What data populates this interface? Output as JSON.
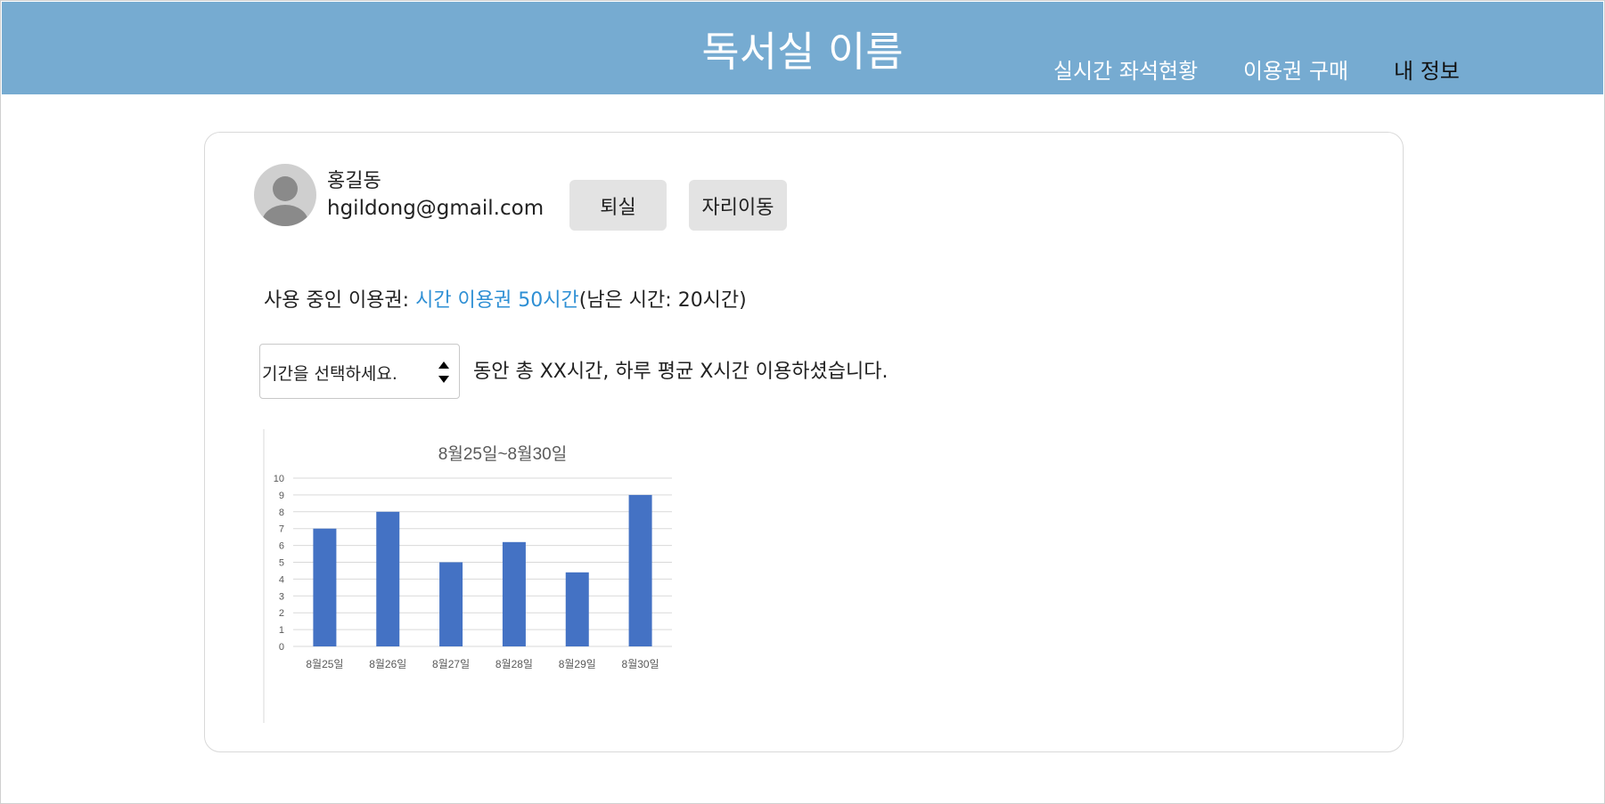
{
  "header": {
    "title": "독서실 이름",
    "nav": [
      "실시간 좌석현황",
      "이용권 구매",
      "내 정보"
    ],
    "background_color": "#76abd1"
  },
  "user": {
    "name": "홍길동",
    "email": "hgildong@gmail.com",
    "avatar_icon": "user-avatar-icon"
  },
  "actions": {
    "checkout_label": "퇴실",
    "move_seat_label": "자리이동"
  },
  "pass": {
    "prefix": "사용 중인 이용권:  ",
    "name": "시간 이용권 50시간",
    "remaining": "(남은 시간:  20시간)",
    "link_color": "#2e8fd4"
  },
  "period": {
    "placeholder": "기간을 선택하세요.",
    "summary": "동안 총 XX시간, 하루 평균 X시간 이용하셨습니다."
  },
  "chart_data": {
    "type": "bar",
    "title": "8월25일~8월30일",
    "categories": [
      "8월25일",
      "8월26일",
      "8월27일",
      "8월28일",
      "8월29일",
      "8월30일"
    ],
    "values": [
      7,
      8,
      5,
      6.2,
      4.4,
      9
    ],
    "ylim": [
      0,
      10
    ],
    "yticks": [
      0,
      1,
      2,
      3,
      4,
      5,
      6,
      7,
      8,
      9,
      10
    ],
    "grid": true,
    "bar_color": "#4472c4"
  }
}
